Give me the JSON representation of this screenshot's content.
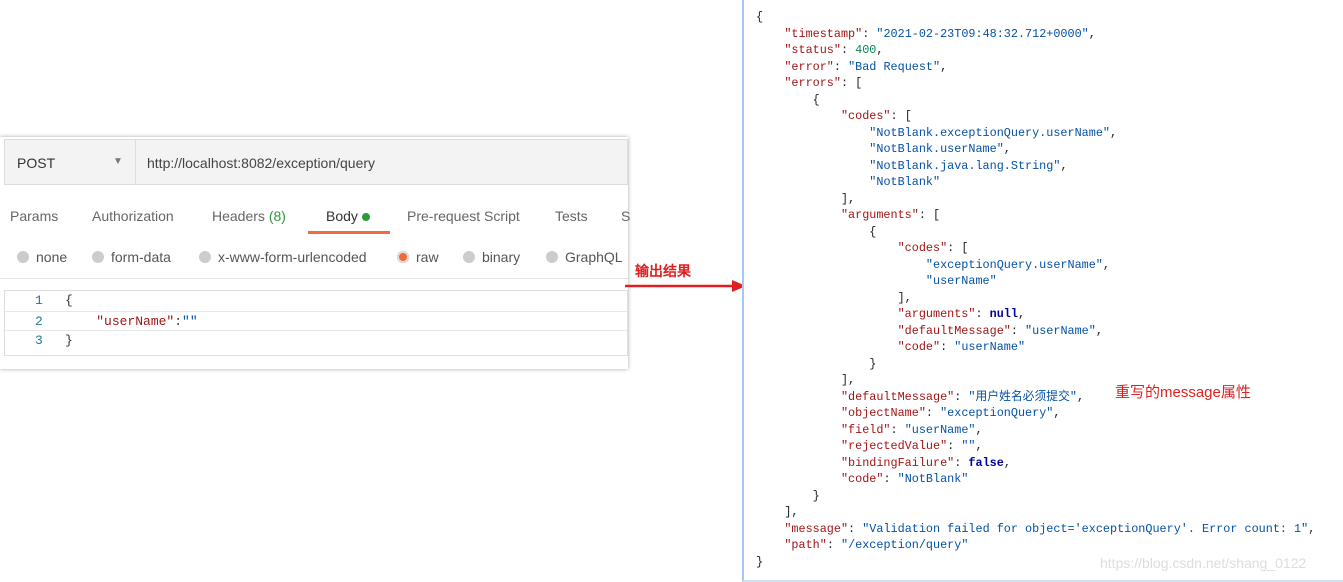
{
  "request": {
    "method": "POST",
    "url": "http://localhost:8082/exception/query",
    "tabs": [
      {
        "label": "Params"
      },
      {
        "label": "Authorization"
      },
      {
        "label": "Headers",
        "count": "(8)"
      },
      {
        "label": "Body"
      },
      {
        "label": "Pre-request Script"
      },
      {
        "label": "Tests"
      },
      {
        "label": "S"
      }
    ],
    "active_tab": "Body",
    "body_types": [
      "none",
      "form-data",
      "x-www-form-urlencoded",
      "raw",
      "binary",
      "GraphQL"
    ],
    "selected_body_type": "raw",
    "editor_lines": [
      {
        "n": "1",
        "code": "{"
      },
      {
        "n": "2",
        "key": "\"userName\"",
        "sep": ":",
        "val": "\"\""
      },
      {
        "n": "3",
        "code": "}"
      }
    ]
  },
  "annotations": {
    "arrow_label": "输出结果",
    "note": "重写的message属性",
    "watermark": "https://blog.csdn.net/shang_0122"
  },
  "colors": {
    "accent": "#f26b3a",
    "key": "#a31515",
    "string": "#0451a5",
    "number": "#098658",
    "annotation": "#e02020"
  },
  "response_lines": [
    {
      "i": 0,
      "c": "{"
    },
    {
      "i": 1,
      "k": "timestamp",
      "v": "\"2021-02-23T09:48:32.712+0000\"",
      "t": "s",
      "p": ","
    },
    {
      "i": 1,
      "k": "status",
      "v": "400",
      "t": "n",
      "p": ","
    },
    {
      "i": 1,
      "k": "error",
      "v": "\"Bad Request\"",
      "t": "s",
      "p": ","
    },
    {
      "i": 1,
      "k": "errors",
      "c": "["
    },
    {
      "i": 2,
      "c": "{"
    },
    {
      "i": 3,
      "k": "codes",
      "c": "["
    },
    {
      "i": 4,
      "v": "\"NotBlank.exceptionQuery.userName\"",
      "t": "s",
      "p": ","
    },
    {
      "i": 4,
      "v": "\"NotBlank.userName\"",
      "t": "s",
      "p": ","
    },
    {
      "i": 4,
      "v": "\"NotBlank.java.lang.String\"",
      "t": "s",
      "p": ","
    },
    {
      "i": 4,
      "v": "\"NotBlank\"",
      "t": "s"
    },
    {
      "i": 3,
      "c": "],"
    },
    {
      "i": 3,
      "k": "arguments",
      "c": "["
    },
    {
      "i": 4,
      "c": "{"
    },
    {
      "i": 5,
      "k": "codes",
      "c": "["
    },
    {
      "i": 6,
      "v": "\"exceptionQuery.userName\"",
      "t": "s",
      "p": ","
    },
    {
      "i": 6,
      "v": "\"userName\"",
      "t": "s"
    },
    {
      "i": 5,
      "c": "],"
    },
    {
      "i": 5,
      "k": "arguments",
      "v": "null",
      "t": "b",
      "p": ","
    },
    {
      "i": 5,
      "k": "defaultMessage",
      "v": "\"userName\"",
      "t": "s",
      "p": ","
    },
    {
      "i": 5,
      "k": "code",
      "v": "\"userName\"",
      "t": "s"
    },
    {
      "i": 4,
      "c": "}"
    },
    {
      "i": 3,
      "c": "],"
    },
    {
      "i": 3,
      "k": "defaultMessage",
      "v": "\"用户姓名必须提交\"",
      "t": "s",
      "p": ","
    },
    {
      "i": 3,
      "k": "objectName",
      "v": "\"exceptionQuery\"",
      "t": "s",
      "p": ","
    },
    {
      "i": 3,
      "k": "field",
      "v": "\"userName\"",
      "t": "s",
      "p": ","
    },
    {
      "i": 3,
      "k": "rejectedValue",
      "v": "\"\"",
      "t": "s",
      "p": ","
    },
    {
      "i": 3,
      "k": "bindingFailure",
      "v": "false",
      "t": "b",
      "p": ","
    },
    {
      "i": 3,
      "k": "code",
      "v": "\"NotBlank\"",
      "t": "s"
    },
    {
      "i": 2,
      "c": "}"
    },
    {
      "i": 1,
      "c": "],"
    },
    {
      "i": 1,
      "k": "message",
      "v": "\"Validation failed for object='exceptionQuery'. Error count: 1\"",
      "t": "s",
      "p": ","
    },
    {
      "i": 1,
      "k": "path",
      "v": "\"/exception/query\"",
      "t": "s"
    },
    {
      "i": 0,
      "c": "}"
    }
  ]
}
